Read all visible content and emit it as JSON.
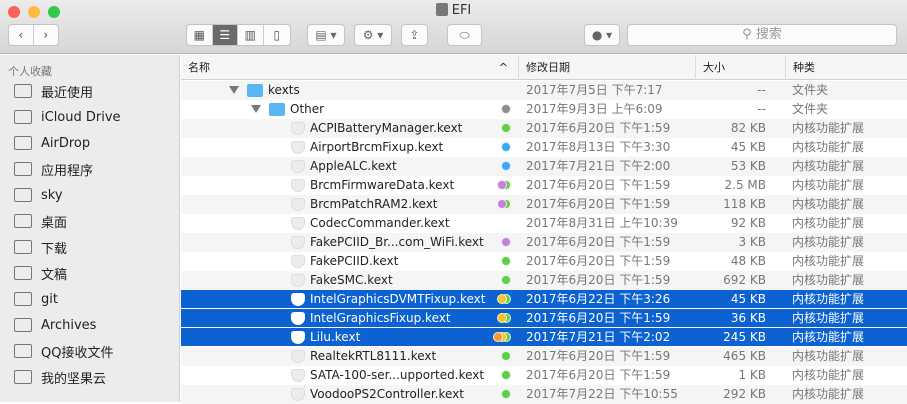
{
  "window": {
    "title": "EFI"
  },
  "toolbar": {
    "search_placeholder": "搜索"
  },
  "sidebar": {
    "heading": "个人收藏",
    "items": [
      {
        "label": "最近使用",
        "icon": "recents-icon"
      },
      {
        "label": "iCloud Drive",
        "icon": "cloud-icon"
      },
      {
        "label": "AirDrop",
        "icon": "airdrop-icon"
      },
      {
        "label": "应用程序",
        "icon": "applications-icon"
      },
      {
        "label": "sky",
        "icon": "home-icon"
      },
      {
        "label": "桌面",
        "icon": "folder-icon"
      },
      {
        "label": "下载",
        "icon": "folder-icon"
      },
      {
        "label": "文稿",
        "icon": "folder-icon"
      },
      {
        "label": "git",
        "icon": "folder-icon"
      },
      {
        "label": "Archives",
        "icon": "folder-icon"
      },
      {
        "label": "QQ接收文件",
        "icon": "folder-icon"
      },
      {
        "label": "我的坚果云",
        "icon": "folder-icon"
      }
    ]
  },
  "columns": {
    "name": "名称",
    "date": "修改日期",
    "size": "大小",
    "kind": "种类"
  },
  "colors": {
    "green": "#5fcf45",
    "blue": "#3da7f5",
    "purple": "#c77ee0",
    "gray": "#8e8e8e",
    "yellow": "#f5c42b",
    "orange": "#f79a2a",
    "selection": "#0b62d0"
  },
  "rows": [
    {
      "name": "kexts",
      "type": "folder",
      "level": 0,
      "date": "2017年7月5日 下午7:17",
      "size": "--",
      "kind": "文件夹",
      "tags": []
    },
    {
      "name": "Other",
      "type": "folder",
      "level": 1,
      "date": "2017年9月3日 上午6:09",
      "size": "--",
      "kind": "文件夹",
      "tags": [
        "gray"
      ]
    },
    {
      "name": "ACPIBatteryManager.kext",
      "type": "kext",
      "date": "2017年6月20日 下午1:59",
      "size": "82 KB",
      "kind": "内核功能扩展",
      "tags": [
        "green"
      ]
    },
    {
      "name": "AirportBrcmFixup.kext",
      "type": "kext",
      "date": "2017年8月13日 下午3:30",
      "size": "45 KB",
      "kind": "内核功能扩展",
      "tags": [
        "blue"
      ]
    },
    {
      "name": "AppleALC.kext",
      "type": "kext",
      "date": "2017年7月21日 下午2:00",
      "size": "53 KB",
      "kind": "内核功能扩展",
      "tags": [
        "blue"
      ]
    },
    {
      "name": "BrcmFirmwareData.kext",
      "type": "kext",
      "date": "2017年6月20日 下午1:59",
      "size": "2.5 MB",
      "kind": "内核功能扩展",
      "tags": [
        "purple",
        "green"
      ]
    },
    {
      "name": "BrcmPatchRAM2.kext",
      "type": "kext",
      "date": "2017年6月20日 下午1:59",
      "size": "118 KB",
      "kind": "内核功能扩展",
      "tags": [
        "purple",
        "green"
      ]
    },
    {
      "name": "CodecCommander.kext",
      "type": "kext",
      "date": "2017年8月31日 上午10:39",
      "size": "92 KB",
      "kind": "内核功能扩展",
      "tags": []
    },
    {
      "name": "FakePCIID_Br...com_WiFi.kext",
      "type": "kext",
      "date": "2017年6月20日 下午1:59",
      "size": "3 KB",
      "kind": "内核功能扩展",
      "tags": [
        "purple"
      ]
    },
    {
      "name": "FakePCIID.kext",
      "type": "kext",
      "date": "2017年6月20日 下午1:59",
      "size": "48 KB",
      "kind": "内核功能扩展",
      "tags": [
        "green"
      ]
    },
    {
      "name": "FakeSMC.kext",
      "type": "kext",
      "date": "2017年6月20日 下午1:59",
      "size": "692 KB",
      "kind": "内核功能扩展",
      "tags": [
        "green"
      ]
    },
    {
      "name": "IntelGraphicsDVMTFixup.kext",
      "type": "kext",
      "selected": true,
      "date": "2017年6月22日 下午3:26",
      "size": "45 KB",
      "kind": "内核功能扩展",
      "tags": [
        "yellow",
        "green"
      ]
    },
    {
      "name": "IntelGraphicsFixup.kext",
      "type": "kext",
      "selected": true,
      "date": "2017年6月20日 下午1:59",
      "size": "36 KB",
      "kind": "内核功能扩展",
      "tags": [
        "yellow",
        "green"
      ]
    },
    {
      "name": "Lilu.kext",
      "type": "kext",
      "selected": true,
      "date": "2017年7月21日 下午2:02",
      "size": "245 KB",
      "kind": "内核功能扩展",
      "tags": [
        "orange",
        "yellow",
        "green"
      ]
    },
    {
      "name": "RealtekRTL8111.kext",
      "type": "kext",
      "date": "2017年6月20日 下午1:59",
      "size": "465 KB",
      "kind": "内核功能扩展",
      "tags": [
        "green"
      ]
    },
    {
      "name": "SATA-100-ser...upported.kext",
      "type": "kext",
      "date": "2017年6月20日 下午1:59",
      "size": "1 KB",
      "kind": "内核功能扩展",
      "tags": [
        "green"
      ]
    },
    {
      "name": "VoodooPS2Controller.kext",
      "type": "kext",
      "date": "2017年7月22日 下午10:55",
      "size": "292 KB",
      "kind": "内核功能扩展",
      "tags": [
        "green"
      ]
    }
  ]
}
